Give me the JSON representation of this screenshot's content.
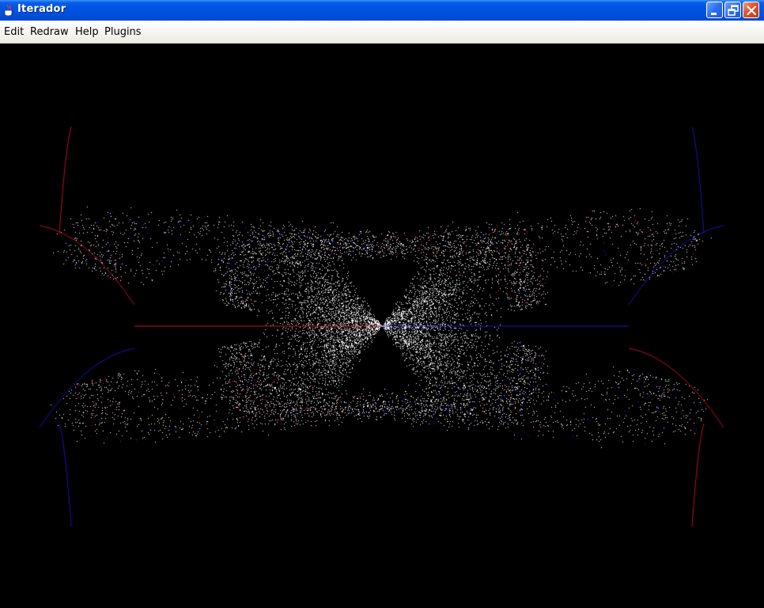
{
  "window": {
    "title": "Iterador"
  },
  "menu": {
    "items": [
      {
        "label": "Edit"
      },
      {
        "label": "Redraw"
      },
      {
        "label": "Help"
      },
      {
        "label": "Plugins"
      }
    ]
  },
  "controls": {
    "minimize_icon": "minimize-icon",
    "restore_icon": "restore-icon",
    "close_icon": "close-icon"
  },
  "canvas": {
    "background": "#000000",
    "colors": [
      "#ff1a3a",
      "#2a1aff"
    ]
  }
}
